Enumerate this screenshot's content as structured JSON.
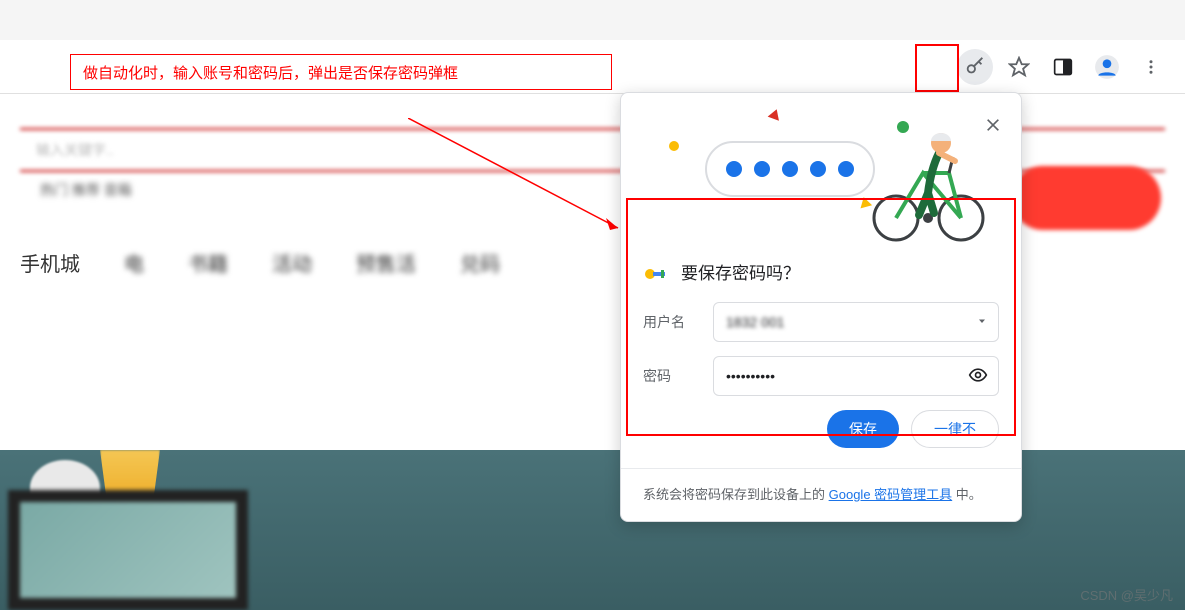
{
  "annotation": {
    "text": "做自动化时，输入账号和密码后，弹出是否保存密码弹框"
  },
  "toolbar": {
    "icons": [
      "key-icon",
      "star-icon",
      "side-panel-icon",
      "profile-icon",
      "menu-dots-icon"
    ]
  },
  "page": {
    "search_placeholder": "输入关键字..",
    "tags": "热门 推荐 音箱",
    "nav": [
      "手机城",
      "电",
      "书籍",
      "活动",
      "预售活",
      "兑码"
    ]
  },
  "popup": {
    "title": "要保存密码吗？",
    "labels": {
      "username": "用户名",
      "password": "密码"
    },
    "values": {
      "username": "1832    001",
      "password_mask": "••••••••••"
    },
    "buttons": {
      "save": "保存",
      "never": "一律不"
    },
    "footer": {
      "prefix": "系统会将密码保存到此设备上的 ",
      "link": "Google 密码管理工具",
      "suffix": " 中。"
    }
  },
  "watermark": "CSDN @吴少凡"
}
